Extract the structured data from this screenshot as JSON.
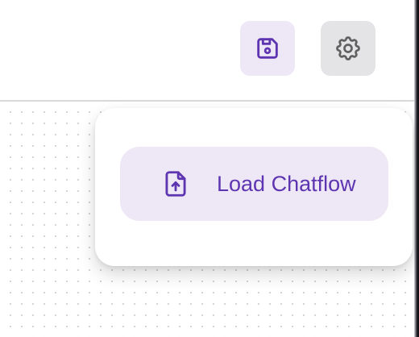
{
  "toolbar": {
    "save_icon": "save-icon",
    "settings_icon": "gear-icon"
  },
  "menu": {
    "items": [
      {
        "label": "Load Chatflow",
        "icon": "file-upload-icon"
      }
    ]
  },
  "colors": {
    "accent": "#5e35b1",
    "accent_bg": "#ede7f6",
    "neutral_button_bg": "#e4e4e6",
    "neutral_icon": "#616161"
  }
}
